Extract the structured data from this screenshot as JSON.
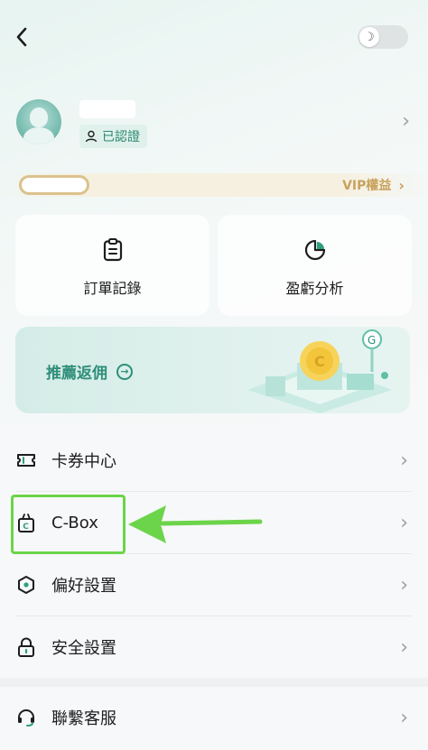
{
  "header": {
    "back_icon": "chevron-left-icon",
    "theme_toggle": {
      "icon": "moon-icon",
      "state": "light"
    }
  },
  "profile": {
    "avatar_icon": "avatar",
    "verified_label": "已認證",
    "verified_icon": "user-icon"
  },
  "vip": {
    "label": "VIP權益",
    "progress": 0
  },
  "cards": [
    {
      "label": "訂單記錄",
      "icon": "clipboard-icon"
    },
    {
      "label": "盈虧分析",
      "icon": "pie-chart-icon"
    }
  ],
  "referral": {
    "label": "推薦返佣",
    "icon": "arrow-right-circle-icon"
  },
  "menu": [
    {
      "label": "卡券中心",
      "icon": "ticket-icon"
    },
    {
      "label": "C-Box",
      "icon": "gift-box-icon"
    },
    {
      "label": "偏好設置",
      "icon": "hexagon-settings-icon"
    },
    {
      "label": "安全設置",
      "icon": "lock-icon"
    },
    {
      "label": "聯繫客服",
      "icon": "headset-icon"
    }
  ],
  "colors": {
    "accent": "#2f8f7a",
    "vip_gold": "#c9a25c",
    "annotation_green": "#6cd44a"
  }
}
